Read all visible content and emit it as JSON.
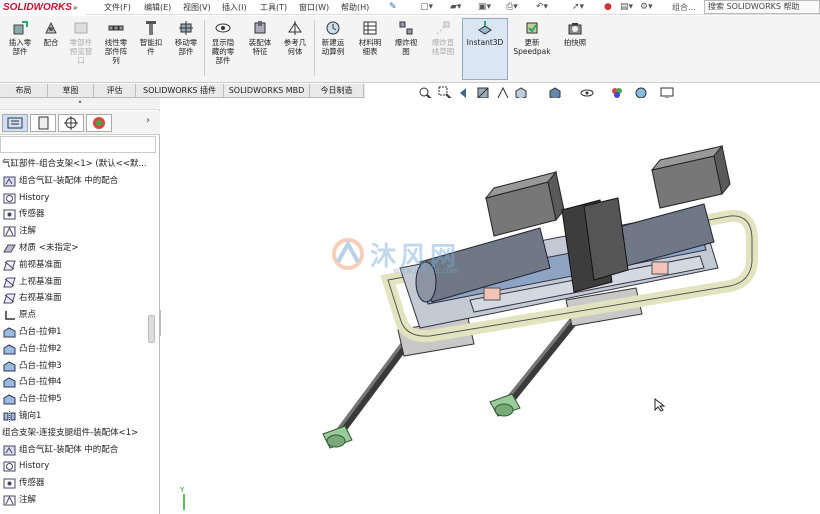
{
  "app": {
    "logo": "SOLIDWORKS"
  },
  "menu": {
    "items": [
      "文件(F)",
      "编辑(E)",
      "视图(V)",
      "插入(I)",
      "工具(T)",
      "窗口(W)",
      "帮助(H)"
    ],
    "assembly_label": "组合...",
    "help_search": "搜索 SOLIDWORKS 帮助"
  },
  "commands": [
    {
      "label": "插入零\n部件",
      "enabled": true
    },
    {
      "label": "配合",
      "enabled": true
    },
    {
      "label": "零部件\n预览窗\n口",
      "enabled": false
    },
    {
      "label": "线性零\n部件阵\n列",
      "enabled": true
    },
    {
      "label": "智能扣\n件",
      "enabled": true
    },
    {
      "label": "移动零\n部件",
      "enabled": true
    },
    {
      "label": "显示隐\n藏的零\n部件",
      "enabled": true
    },
    {
      "label": "装配体\n特征",
      "enabled": true
    },
    {
      "label": "参考几\n何体",
      "enabled": true
    },
    {
      "label": "新建运\n动算例",
      "enabled": true
    },
    {
      "label": "材料明\n细表",
      "enabled": true
    },
    {
      "label": "爆炸视\n图",
      "enabled": true
    },
    {
      "label": "爆炸直\n线草图",
      "enabled": false
    },
    {
      "label": "Instant3D",
      "enabled": true
    },
    {
      "label": "更新\nSpeedpak",
      "enabled": true
    },
    {
      "label": "拍快照",
      "enabled": true
    }
  ],
  "tabs": [
    "布局",
    "草图",
    "评估",
    "SOLIDWORKS 插件",
    "SOLIDWORKS MBD",
    "今日制造"
  ],
  "tree": [
    {
      "text": "气缸部件-组合支架<1> (默认<<默...",
      "icon": "none",
      "indent": 0
    },
    {
      "text": "组合气缸-装配体 中的配合",
      "icon": "mates-icon",
      "indent": 1
    },
    {
      "text": "History",
      "icon": "history-icon",
      "indent": 1
    },
    {
      "text": "传感器",
      "icon": "sensor-icon",
      "indent": 1
    },
    {
      "text": "注解",
      "icon": "annotation-icon",
      "indent": 1
    },
    {
      "text": "材质 <未指定>",
      "icon": "material-icon",
      "indent": 1
    },
    {
      "text": "前视基准面",
      "icon": "plane-icon",
      "indent": 1
    },
    {
      "text": "上视基准面",
      "icon": "plane-icon",
      "indent": 1
    },
    {
      "text": "右视基准面",
      "icon": "plane-icon",
      "indent": 1
    },
    {
      "text": "原点",
      "icon": "origin-icon",
      "indent": 1
    },
    {
      "text": "凸台-拉伸1",
      "icon": "extrude-icon",
      "indent": 1
    },
    {
      "text": "凸台-拉伸2",
      "icon": "extrude-icon",
      "indent": 1
    },
    {
      "text": "凸台-拉伸3",
      "icon": "extrude-icon",
      "indent": 1
    },
    {
      "text": "凸台-拉伸4",
      "icon": "extrude-icon",
      "indent": 1
    },
    {
      "text": "凸台-拉伸5",
      "icon": "extrude-icon",
      "indent": 1
    },
    {
      "text": "镜向1",
      "icon": "mirror-icon",
      "indent": 1
    },
    {
      "text": "组合支架-连接支腿组件-装配体<1>",
      "icon": "none",
      "indent": 0
    },
    {
      "text": "组合气缸-装配体 中的配合",
      "icon": "mates-icon",
      "indent": 1
    },
    {
      "text": "History",
      "icon": "history-icon",
      "indent": 1
    },
    {
      "text": "传感器",
      "icon": "sensor-icon",
      "indent": 1
    },
    {
      "text": "注解",
      "icon": "annotation-icon",
      "indent": 1
    }
  ],
  "watermark": {
    "text": "沐风网",
    "url": "www.mfcad.com"
  },
  "colors": {
    "accent": "#c8102e",
    "selection": "#cfe0f5",
    "watermark": "#7aa9d6"
  }
}
